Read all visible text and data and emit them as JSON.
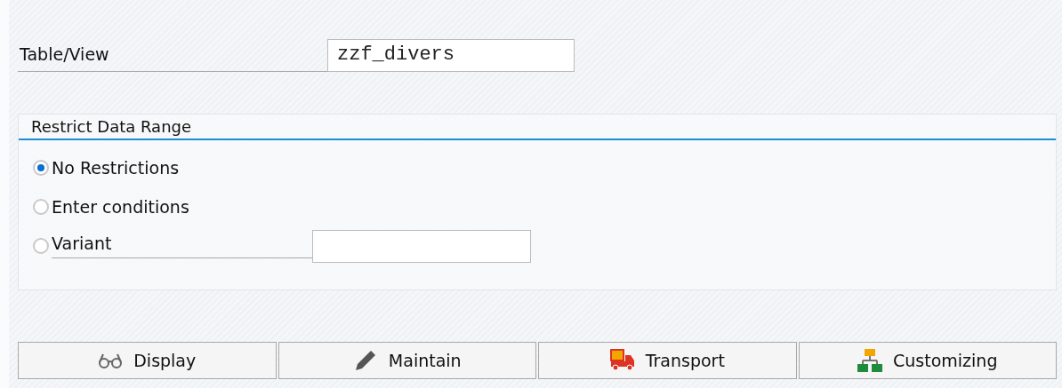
{
  "table_view": {
    "label": "Table/View",
    "value": "zzf_divers"
  },
  "restrict_data_range": {
    "title": "Restrict Data Range",
    "options": [
      {
        "label": "No Restrictions",
        "selected": true,
        "kind": "plain"
      },
      {
        "label": "Enter conditions",
        "selected": false,
        "kind": "plain"
      },
      {
        "label": "Variant",
        "selected": false,
        "kind": "field"
      }
    ]
  },
  "buttons": [
    {
      "label": "Display",
      "kind": "glasses"
    },
    {
      "label": "Maintain",
      "kind": "pencil"
    },
    {
      "label": "Transport",
      "kind": "truck"
    },
    {
      "label": "Customizing",
      "kind": "hierarchy"
    }
  ]
}
